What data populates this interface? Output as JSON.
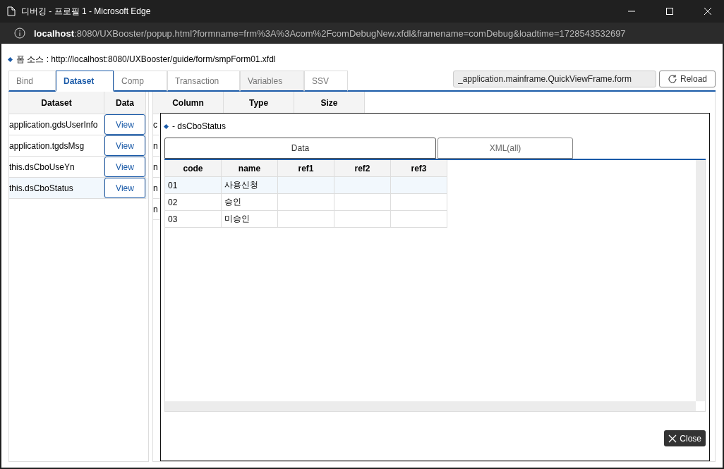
{
  "window": {
    "title": "디버깅 - 프로필 1 - Microsoft Edge"
  },
  "address": {
    "host": "localhost",
    "rest": ":8080/UXBooster/popup.html?formname=frm%3A%3Acom%2FcomDebugNew.xfdl&framename=comDebug&loadtime=1728543532697"
  },
  "source": {
    "label": "폼 소스 : http://localhost:8080/UXBooster/guide/form/smpForm01.xfdl"
  },
  "tabs": [
    {
      "label": "Bind",
      "selected": false,
      "disabled": false
    },
    {
      "label": "Dataset",
      "selected": true,
      "disabled": false
    },
    {
      "label": "Comp",
      "selected": false,
      "disabled": false
    },
    {
      "label": "Transaction",
      "selected": false,
      "disabled": false
    },
    {
      "label": "Variables",
      "selected": false,
      "disabled": true
    },
    {
      "label": "SSV",
      "selected": false,
      "disabled": false
    }
  ],
  "form_path": {
    "value": "_application.mainframe.QuickViewFrame.form"
  },
  "reload_button": {
    "label": "Reload"
  },
  "dataset_grid": {
    "columns": [
      "Dataset",
      "Data"
    ],
    "rows": [
      {
        "name": "application.gdsUserInfo",
        "button": "View",
        "selected": false
      },
      {
        "name": "application.tgdsMsg",
        "button": "View",
        "selected": false
      },
      {
        "name": "this.dsCboUseYn",
        "button": "View",
        "selected": false
      },
      {
        "name": "this.dsCboStatus",
        "button": "View",
        "selected": true
      }
    ]
  },
  "column_grid": {
    "columns": [
      "Column",
      "Type",
      "Size"
    ],
    "rows": [
      "c",
      "n",
      "n",
      "n",
      "n"
    ]
  },
  "popup": {
    "title": "- dsCboStatus",
    "tabs": [
      {
        "label": "Data",
        "selected": true
      },
      {
        "label": "XML(all)",
        "selected": false
      }
    ],
    "columns": [
      "code",
      "name",
      "ref1",
      "ref2",
      "ref3"
    ],
    "rows": [
      {
        "cells": [
          "01",
          "사용신청",
          "",
          "",
          ""
        ],
        "selected": true
      },
      {
        "cells": [
          "02",
          "승인",
          "",
          "",
          ""
        ],
        "selected": false
      },
      {
        "cells": [
          "03",
          "미승인",
          "",
          "",
          ""
        ],
        "selected": false
      }
    ],
    "close_button": {
      "label": "Close"
    }
  }
}
